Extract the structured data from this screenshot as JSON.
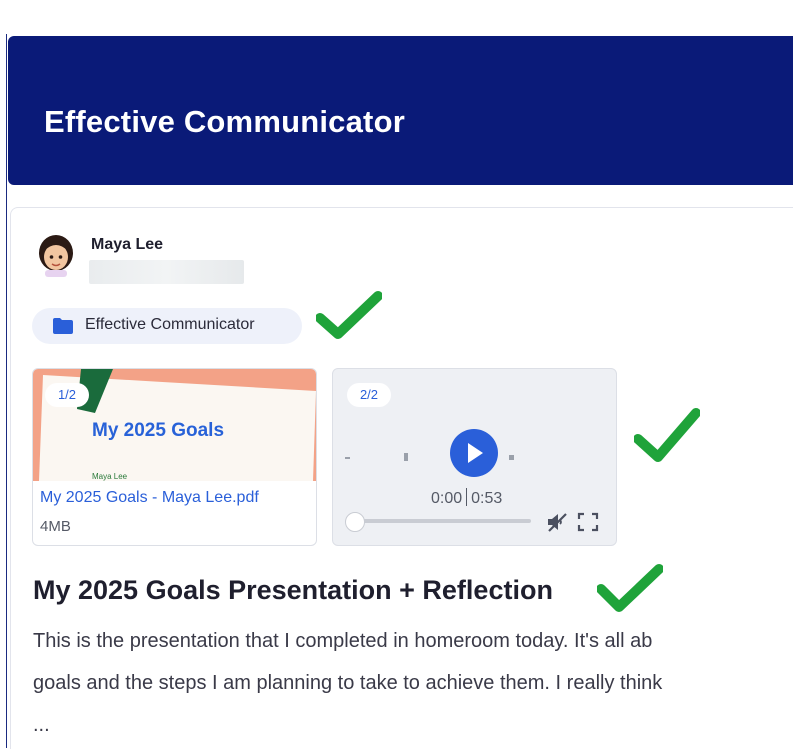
{
  "header": {
    "title": "Effective Communicator"
  },
  "post": {
    "author": {
      "name": "Maya Lee"
    },
    "tag": {
      "label": "Effective Communicator",
      "icon": "folder-icon"
    },
    "attachments": [
      {
        "badge": "1/2",
        "thumbnail_title": "My 2025 Goals",
        "thumbnail_subtitle": "Maya Lee",
        "file_name": "My 2025 Goals - Maya Lee.pdf",
        "file_size": "4MB"
      },
      {
        "badge": "2/2",
        "current_time": "0:00",
        "duration": "0:53",
        "controls": [
          "play-icon",
          "mute-icon",
          "fullscreen-icon"
        ]
      }
    ],
    "title": "My 2025 Goals Presentation + Reflection",
    "body_lines": [
      "This is the presentation  that I completed in homeroom today. It's all ab",
      "goals and the steps I am planning to take to achieve them. I really think",
      "..."
    ]
  },
  "colors": {
    "header_bg": "#0a1a78",
    "accent_blue": "#2a5fd9",
    "check_green": "#1fa33a"
  }
}
